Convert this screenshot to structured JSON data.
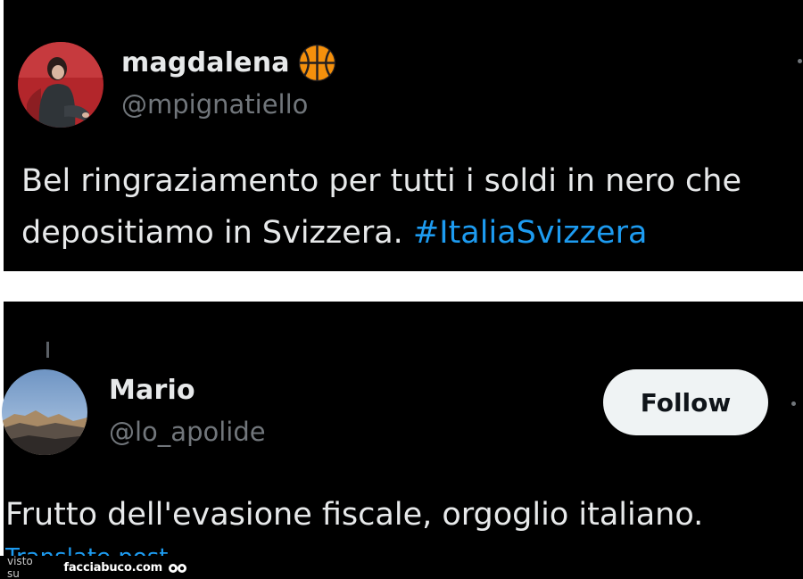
{
  "tweets": [
    {
      "display_name": "magdalena",
      "handle": "@mpignatiello",
      "name_emoji": "basketball-icon",
      "text": "Bel ringraziamento per tutti i soldi in nero che depositiamo in Svizzera. ",
      "hashtag": "#ItaliaSvizzera"
    },
    {
      "display_name": "Mario",
      "handle": "@lo_apolide",
      "follow_label": "Follow",
      "text": "Frutto dell'evasione fiscale, orgoglio italiano.",
      "translate_label": "Translate post"
    }
  ],
  "watermark": {
    "prefix": "visto su",
    "site": "facciabuco.com"
  },
  "colors": {
    "background": "#000000",
    "text": "#e7e9ea",
    "secondary": "#71767b",
    "accent": "#1d9bf0",
    "follow_bg": "#eff3f4"
  }
}
